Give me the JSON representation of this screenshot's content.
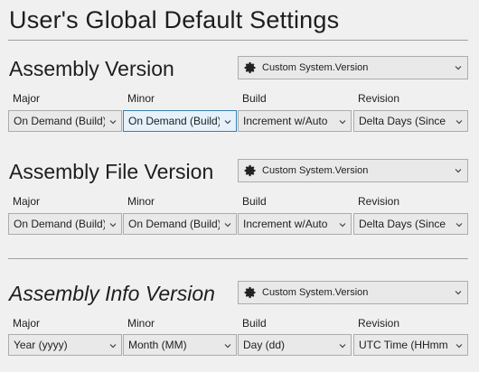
{
  "page": {
    "title": "User's Global Default Settings"
  },
  "sections": [
    {
      "title": "Assembly Version",
      "preset": "Custom System.Version",
      "columns": [
        {
          "label": "Major",
          "value": "On Demand (Build)"
        },
        {
          "label": "Minor",
          "value": "On Demand (Build)"
        },
        {
          "label": "Build",
          "value": "Increment w/Auto"
        },
        {
          "label": "Revision",
          "value": "Delta Days (Since"
        }
      ]
    },
    {
      "title": "Assembly File Version",
      "preset": "Custom System.Version",
      "columns": [
        {
          "label": "Major",
          "value": "On Demand (Build)"
        },
        {
          "label": "Minor",
          "value": "On Demand (Build)"
        },
        {
          "label": "Build",
          "value": "Increment w/Auto"
        },
        {
          "label": "Revision",
          "value": "Delta Days (Since"
        }
      ]
    },
    {
      "title": "Assembly Info Version",
      "preset": "Custom System.Version",
      "columns": [
        {
          "label": "Major",
          "value": "Year (yyyy)"
        },
        {
          "label": "Minor",
          "value": "Month (MM)"
        },
        {
          "label": "Build",
          "value": "Day (dd)"
        },
        {
          "label": "Revision",
          "value": "UTC Time (HHmm"
        }
      ]
    }
  ],
  "icons": {
    "preset": "gear-icon",
    "dropdown": "chevron-down-icon"
  },
  "colors": {
    "background": "#f0f0f0",
    "focus_border": "#3c7fb1",
    "focus_fill": "#e5f1fb"
  }
}
